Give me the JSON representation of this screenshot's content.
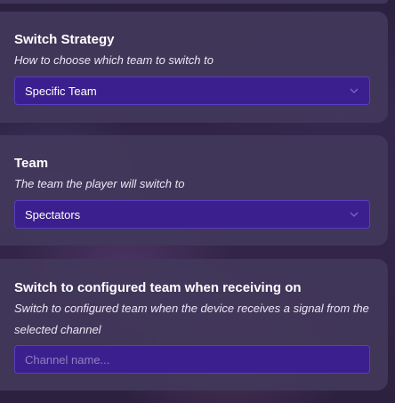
{
  "switch_strategy": {
    "title": "Switch Strategy",
    "description": "How to choose which team to switch to",
    "selected": "Specific Team"
  },
  "team": {
    "title": "Team",
    "description": "The team the player will switch to",
    "selected": "Spectators"
  },
  "receive_channel": {
    "title": "Switch to configured team when receiving on",
    "description": "Switch to configured team when the device receives a signal from the selected channel",
    "value": "",
    "placeholder": "Channel name..."
  },
  "colors": {
    "card_bg": "#42385a",
    "field_bg": "#3c1f8e",
    "field_border": "#5a3cc0",
    "placeholder": "#8e80bd"
  },
  "icons": {
    "select_chevron": "chevron-down-icon"
  }
}
